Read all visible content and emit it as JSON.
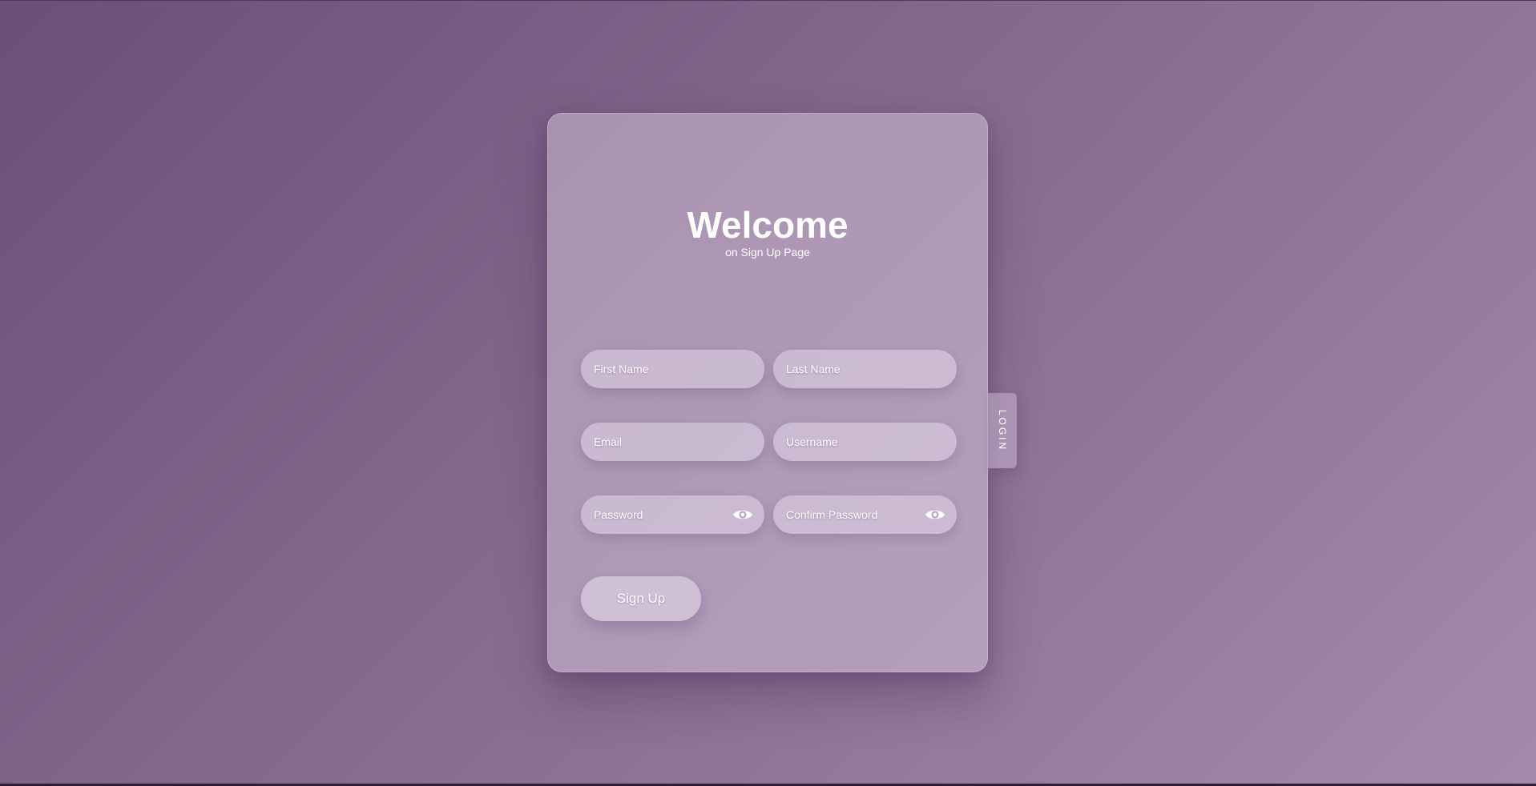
{
  "header": {
    "title": "Welcome",
    "subtitle": "on Sign Up Page"
  },
  "form": {
    "first_name": {
      "placeholder": "First Name",
      "value": ""
    },
    "last_name": {
      "placeholder": "Last Name",
      "value": ""
    },
    "email": {
      "placeholder": "Email",
      "value": ""
    },
    "username": {
      "placeholder": "Username",
      "value": ""
    },
    "password": {
      "placeholder": "Password",
      "value": "",
      "icon": "eye-icon"
    },
    "confirm_password": {
      "placeholder": "Confirm Password",
      "value": "",
      "icon": "eye-icon"
    },
    "submit_label": "Sign Up"
  },
  "side_tab": {
    "label": "LOGIN"
  },
  "colors": {
    "background_start": "#6a4f79",
    "background_end": "#a68aae",
    "text": "#ffffff"
  }
}
